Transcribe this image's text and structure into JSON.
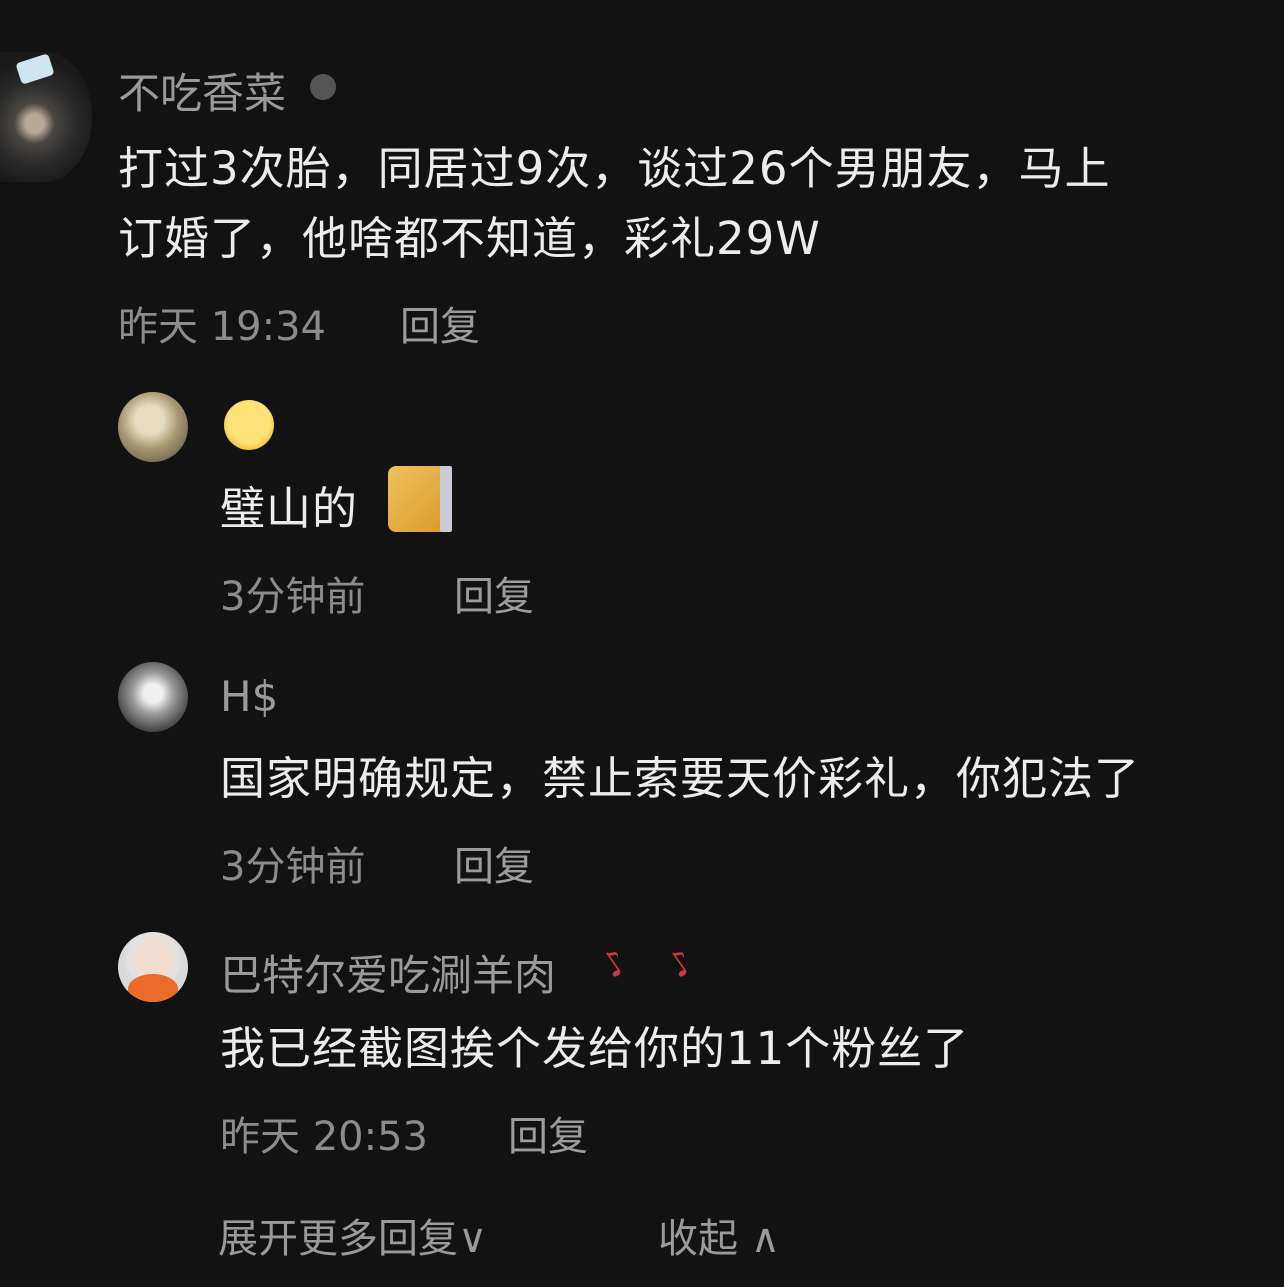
{
  "comment": {
    "author": "不吃香菜",
    "text_line1": "打过3次胎，同居过9次，谈过26个男朋友，马上",
    "text_line2": "订婚了，他啥都不知道，彩礼29W",
    "time": "昨天 19:34",
    "reply_label": "回复"
  },
  "replies": [
    {
      "author_emoji": "crying-face-emoji",
      "text": "璧山的",
      "sticker": "cat-sticker",
      "time": "3分钟前",
      "reply_label": "回复"
    },
    {
      "author": "H$",
      "text": "国家明确规定，禁止索要天价彩礼，你犯法了",
      "time": "3分钟前",
      "reply_label": "回复"
    },
    {
      "author": "巴特尔爱吃涮羊肉",
      "author_icons": [
        "guitar-icon",
        "guitar-icon"
      ],
      "text": "我已经截图挨个发给你的11个粉丝了",
      "time": "昨天 20:53",
      "reply_label": "回复"
    }
  ],
  "footer": {
    "expand_label": "展开更多回复∨",
    "collapse_label": "收起 ∧"
  }
}
